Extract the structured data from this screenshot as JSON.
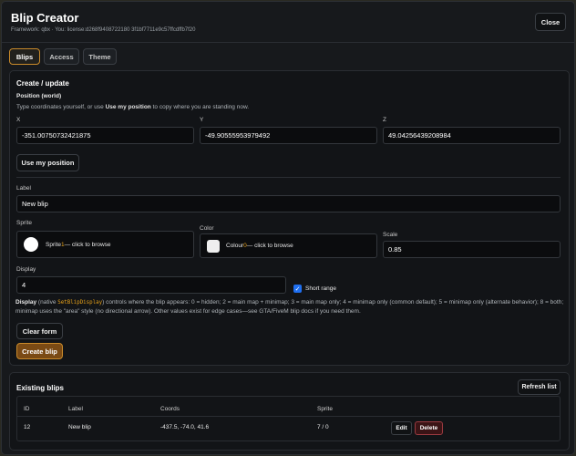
{
  "window": {
    "title": "Blip Creator",
    "subtitle": "Framework: qbx · You: license:d268f9408722180 3f1bf7711e9c57ffcdffb7f20",
    "close_label": "Close"
  },
  "tabs": [
    {
      "label": "Blips",
      "active": true
    },
    {
      "label": "Access",
      "active": false
    },
    {
      "label": "Theme",
      "active": false
    }
  ],
  "create": {
    "section_title": "Create / update",
    "position_label": "Position (world)",
    "position_help_pre": "Type coordinates yourself, or use ",
    "position_help_bold": "Use my position",
    "position_help_post": " to copy where you are standing now.",
    "x_label": "X",
    "y_label": "Y",
    "z_label": "Z",
    "x_value": "-351.00750732421875",
    "y_value": "-49.90555953979492",
    "z_value": "49.04256439208984",
    "use_position_label": "Use my position",
    "label_label": "Label",
    "label_value": "New blip",
    "sprite_label": "Sprite",
    "sprite_text_pre": "Sprite ",
    "sprite_number": "1",
    "sprite_text_post": " — click to browse",
    "color_label": "Color",
    "color_text_pre": "Colour ",
    "color_number": "0",
    "color_text_post": " — click to browse",
    "scale_label": "Scale",
    "scale_value": "0.85",
    "display_label": "Display",
    "display_value": "4",
    "short_range_label": "Short range",
    "short_range_checked": true,
    "display_help_bold": "Display",
    "display_help_native": " (native ",
    "display_help_code": "SetBlipDisplay",
    "display_help_rest": ") controls where the blip appears: 0 = hidden; 2 = main map + minimap; 3 = main map only; 4 = minimap only (common default); 5 = minimap only (alternate behavior); 8 = both; minimap uses the \"area\" style (no directional arrow). Other values exist for edge cases—see GTA/FiveM blip docs if you need them.",
    "clear_label": "Clear form",
    "create_label": "Create blip"
  },
  "existing": {
    "section_title": "Existing blips",
    "refresh_label": "Refresh list",
    "columns": [
      "ID",
      "Label",
      "Coords",
      "Sprite"
    ],
    "rows": [
      {
        "id": "12",
        "label": "New blip",
        "coords": "-437.5, -74.0, 41.6",
        "sprite": "7 / 0",
        "edit_label": "Edit",
        "delete_label": "Delete"
      }
    ]
  },
  "colors": {
    "accent": "#c98a2a",
    "orange_text": "#e5a019",
    "checkbox": "#1f6ff0",
    "danger": "#9a3a40"
  }
}
